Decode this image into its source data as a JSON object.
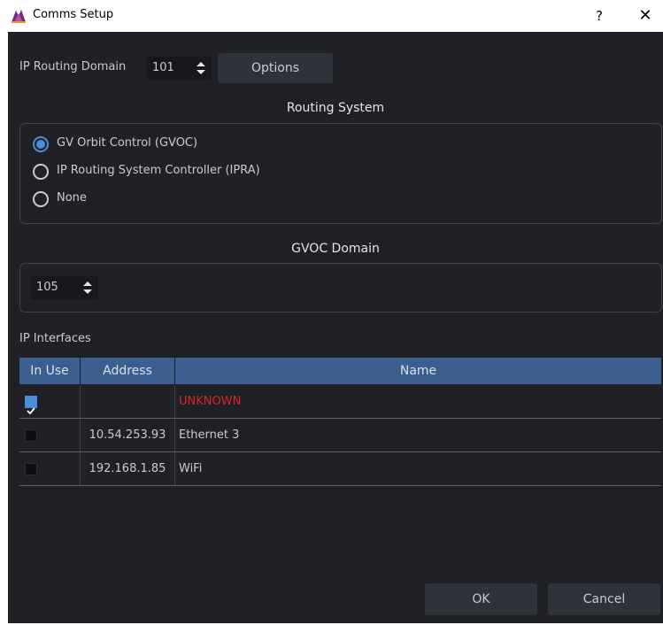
{
  "window": {
    "title": "Comms Setup",
    "help": "?",
    "close": "✕"
  },
  "routing_domain": {
    "label": "IP Routing Domain",
    "value": "101",
    "options_label": "Options"
  },
  "routing_system": {
    "title": "Routing System",
    "options": [
      "GV Orbit Control (GVOC)",
      "IP Routing System Controller (IPRA)",
      "None"
    ],
    "selected": "GV Orbit Control (GVOC)"
  },
  "gvoc_domain": {
    "title": "GVOC Domain",
    "value": "105"
  },
  "ip_interfaces": {
    "label": "IP Interfaces",
    "columns": [
      "In Use",
      "Address",
      "Name"
    ],
    "rows": [
      {
        "in_use": true,
        "address": "",
        "name": "UNKNOWN"
      },
      {
        "in_use": false,
        "address": "10.54.253.93",
        "name": "Ethernet 3"
      },
      {
        "in_use": false,
        "address": "192.168.1.85",
        "name": "WiFi"
      }
    ]
  },
  "footer": {
    "ok": "OK",
    "cancel": "Cancel"
  },
  "colors": {
    "accent": "#4a8fd6",
    "header": "#3a5e8e",
    "unknown": "#d9262b",
    "background": "#1f2126"
  }
}
